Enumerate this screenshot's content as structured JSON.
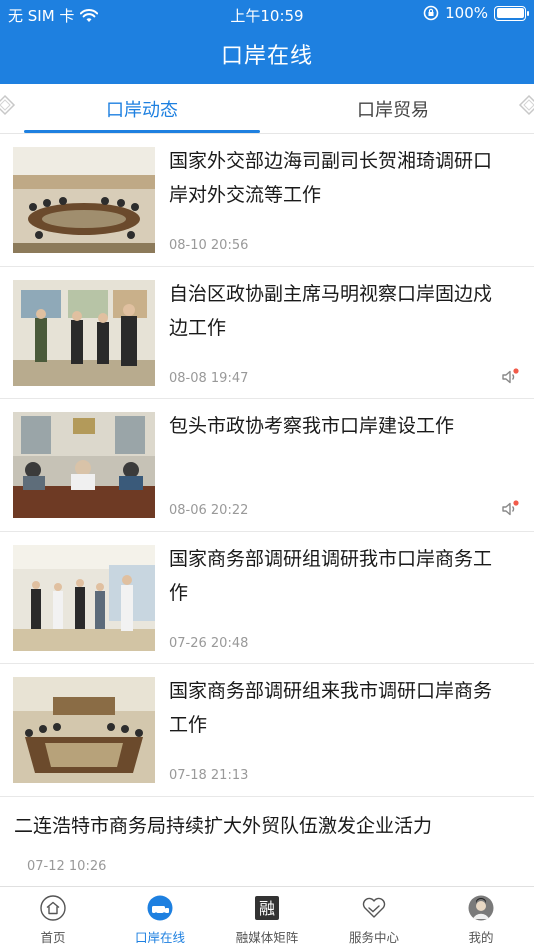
{
  "status_bar": {
    "carrier": "无 SIM 卡",
    "time": "上午10:59",
    "battery": "100%"
  },
  "app": {
    "title": "口岸在线"
  },
  "tabs": [
    {
      "label": "口岸动态",
      "active": true
    },
    {
      "label": "口岸贸易",
      "active": false
    }
  ],
  "news": [
    {
      "title": "国家外交部边海司副司长贺湘琦调研口岸对外交流等工作",
      "time": "08-10 20:56",
      "has_audio": false
    },
    {
      "title": "自治区政协副主席马明视察口岸固边戍边工作",
      "time": "08-08 19:47",
      "has_audio": true
    },
    {
      "title": "包头市政协考察我市口岸建设工作",
      "time": "08-06 20:22",
      "has_audio": true
    },
    {
      "title": "国家商务部调研组调研我市口岸商务工作",
      "time": "07-26 20:48",
      "has_audio": false
    },
    {
      "title": "国家商务部调研组来我市调研口岸商务工作",
      "time": "07-18 21:13",
      "has_audio": false
    },
    {
      "title": "二连浩特市商务局持续扩大外贸队伍激发企业活力",
      "time": "07-12 10:26",
      "has_audio": false
    }
  ],
  "bottom_nav": [
    {
      "label": "首页",
      "icon": "home-icon",
      "active": false
    },
    {
      "label": "口岸在线",
      "icon": "port-icon",
      "active": true
    },
    {
      "label": "融媒体矩阵",
      "icon": "media-matrix-icon",
      "active": false
    },
    {
      "label": "服务中心",
      "icon": "handshake-icon",
      "active": false
    },
    {
      "label": "我的",
      "icon": "avatar-icon",
      "active": false
    }
  ],
  "colors": {
    "primary": "#1e80e0",
    "text": "#1a1a1a",
    "muted": "#999999"
  }
}
